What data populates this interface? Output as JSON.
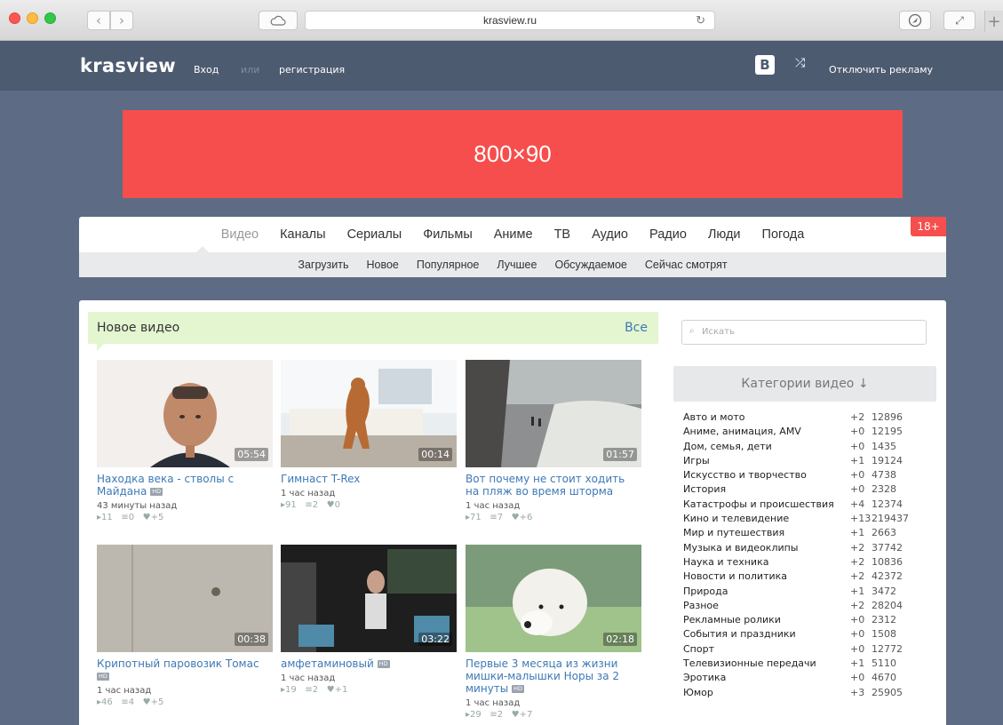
{
  "browser": {
    "url": "krasview.ru"
  },
  "header": {
    "logo": "krasview",
    "login": "Вход",
    "or": "или",
    "register": "регистрация",
    "vk": "В",
    "shuffle": "⤮",
    "disable_ads": "Отключить рекламу"
  },
  "banner": {
    "label": "800×90"
  },
  "main_nav": {
    "items": [
      "Видео",
      "Каналы",
      "Сериалы",
      "Фильмы",
      "Аниме",
      "ТВ",
      "Аудио",
      "Радио",
      "Люди",
      "Погода"
    ],
    "active": "Видео",
    "age_badge": "18+"
  },
  "sub_nav": {
    "items": [
      "Загрузить",
      "Новое",
      "Популярное",
      "Лучшее",
      "Обсуждаемое",
      "Сейчас смотрят"
    ]
  },
  "new_video": {
    "title": "Новое видео",
    "all_link": "Все",
    "hd_label": "HD",
    "videos": [
      {
        "title": "Находка века - стволы с Майдана",
        "hd": true,
        "duration": "05:54",
        "time": "43 минуты назад",
        "views": "11",
        "comments": "0",
        "likes": "+5"
      },
      {
        "title": "Гимнаст T-Rex",
        "hd": false,
        "duration": "00:14",
        "time": "1 час назад",
        "views": "91",
        "comments": "2",
        "likes": "0"
      },
      {
        "title": "Вот почему не стоит ходить на пляж во время шторма",
        "hd": false,
        "duration": "01:57",
        "time": "1 час назад",
        "views": "71",
        "comments": "7",
        "likes": "+6"
      },
      {
        "title": "Крипотный паровозик Томас",
        "hd": true,
        "duration": "00:38",
        "time": "1 час назад",
        "views": "46",
        "comments": "4",
        "likes": "+5"
      },
      {
        "title": "амфетаминовый",
        "hd": true,
        "duration": "03:22",
        "time": "1 час назад",
        "views": "19",
        "comments": "2",
        "likes": "+1"
      },
      {
        "title": "Первые 3 месяца из жизни мишки-малышки Норы за 2 минуты",
        "hd": true,
        "duration": "02:18",
        "time": "1 час назад",
        "views": "29",
        "comments": "2",
        "likes": "+7"
      }
    ]
  },
  "sidebar": {
    "search_placeholder": "Искать",
    "categories_title": "Категории видео ↓",
    "categories": [
      {
        "name": "Авто и мото",
        "delta": "+2",
        "count": "12896"
      },
      {
        "name": "Аниме, анимация, AMV",
        "delta": "+0",
        "count": "12195"
      },
      {
        "name": "Дом, семья, дети",
        "delta": "+0",
        "count": "1435"
      },
      {
        "name": "Игры",
        "delta": "+1",
        "count": "19124"
      },
      {
        "name": "Искусство и творчество",
        "delta": "+0",
        "count": "4738"
      },
      {
        "name": "История",
        "delta": "+0",
        "count": "2328"
      },
      {
        "name": "Катастрофы и происшествия",
        "delta": "+4",
        "count": "12374"
      },
      {
        "name": "Кино и телевидение",
        "delta": "+13",
        "count": "219437"
      },
      {
        "name": "Мир и путешествия",
        "delta": "+1",
        "count": "2663"
      },
      {
        "name": "Музыка и видеоклипы",
        "delta": "+2",
        "count": "37742"
      },
      {
        "name": "Наука и техника",
        "delta": "+2",
        "count": "10836"
      },
      {
        "name": "Новости и политика",
        "delta": "+2",
        "count": "42372"
      },
      {
        "name": "Природа",
        "delta": "+1",
        "count": "3472"
      },
      {
        "name": "Разное",
        "delta": "+2",
        "count": "28204"
      },
      {
        "name": "Рекламные ролики",
        "delta": "+0",
        "count": "2312"
      },
      {
        "name": "События и праздники",
        "delta": "+0",
        "count": "1508"
      },
      {
        "name": "Спорт",
        "delta": "+0",
        "count": "12772"
      },
      {
        "name": "Телевизионные передачи",
        "delta": "+1",
        "count": "5110"
      },
      {
        "name": "Эротика",
        "delta": "+0",
        "count": "4670"
      },
      {
        "name": "Юмор",
        "delta": "+3",
        "count": "25905"
      }
    ]
  },
  "colors": {
    "page_bg": "#5d6c84",
    "header_bg": "#4d5b70",
    "banner": "#f64e4c",
    "link": "#3d79b6",
    "new_video_bar": "#e3f6d0"
  }
}
